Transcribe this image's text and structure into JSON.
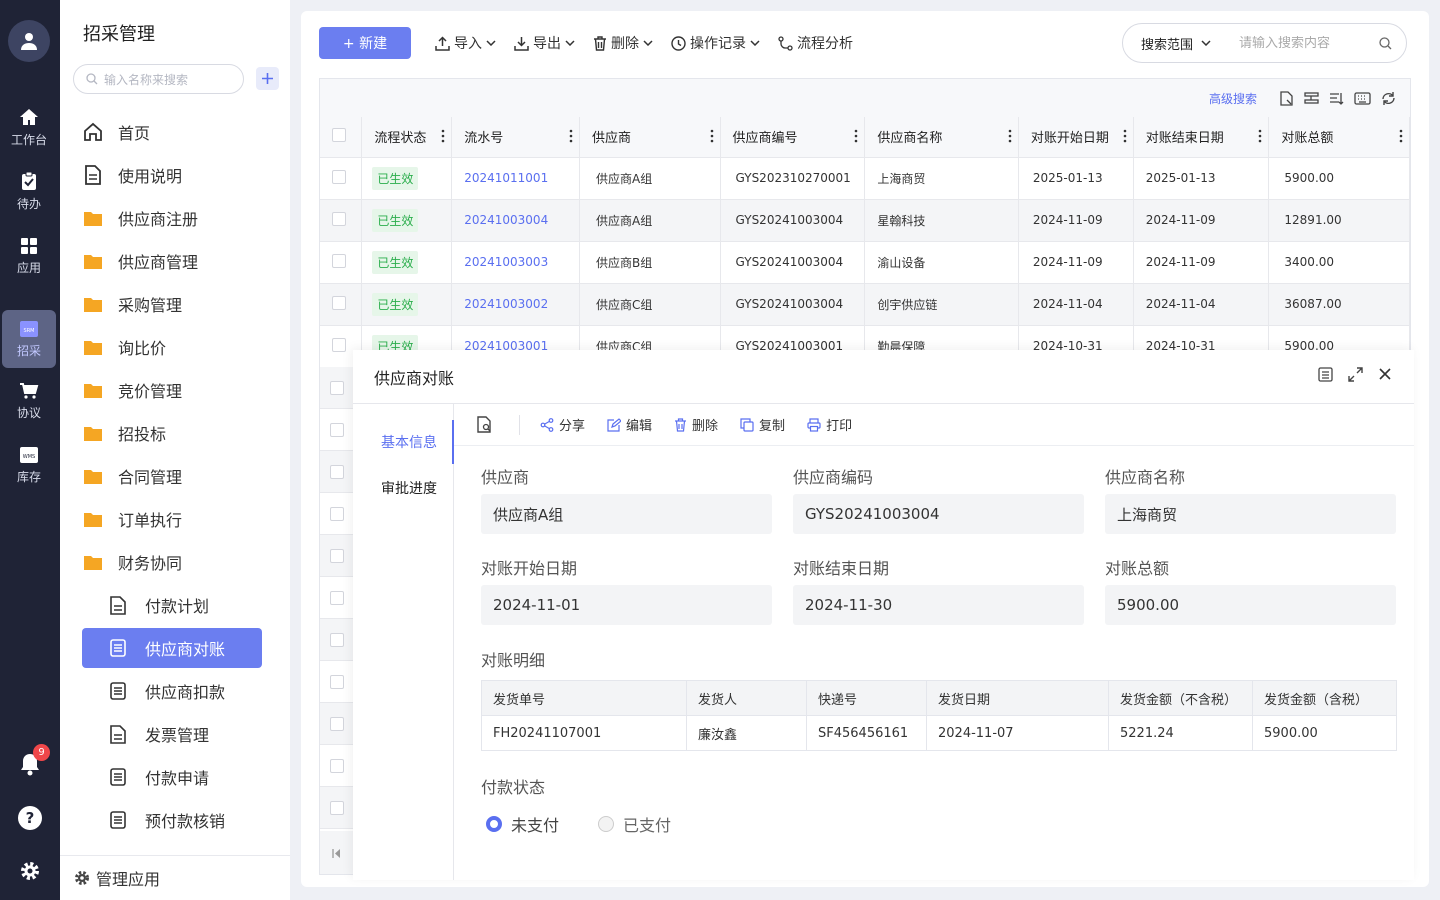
{
  "rail": {
    "items": [
      {
        "label": "工作台"
      },
      {
        "label": "待办"
      },
      {
        "label": "应用"
      },
      {
        "label": "招采",
        "logo": "SRM"
      },
      {
        "label": "协议"
      },
      {
        "label": "库存",
        "logo": "WMS"
      }
    ],
    "notification_count": "9"
  },
  "menu": {
    "title": "招采管理",
    "search_placeholder": "输入名称来搜索",
    "items": [
      {
        "label": "首页"
      },
      {
        "label": "使用说明"
      },
      {
        "label": "供应商注册"
      },
      {
        "label": "供应商管理"
      },
      {
        "label": "采购管理"
      },
      {
        "label": "询比价"
      },
      {
        "label": "竞价管理"
      },
      {
        "label": "招投标"
      },
      {
        "label": "合同管理"
      },
      {
        "label": "订单执行"
      },
      {
        "label": "财务协同"
      }
    ],
    "sub_items": [
      {
        "label": "付款计划"
      },
      {
        "label": "供应商对账"
      },
      {
        "label": "供应商扣款"
      },
      {
        "label": "发票管理"
      },
      {
        "label": "付款申请"
      },
      {
        "label": "预付款核销"
      }
    ],
    "footer": "管理应用"
  },
  "toolbar": {
    "new_label": "+ 新建",
    "import": "导入",
    "export": "导出",
    "delete": "删除",
    "log": "操作记录",
    "flow": "流程分析",
    "search_scope": "搜索范围",
    "search_placeholder": "请输入搜索内容",
    "advanced_search": "高级搜索"
  },
  "grid": {
    "columns": [
      "流程状态",
      "流水号",
      "供应商",
      "供应商编号",
      "供应商名称",
      "对账开始日期",
      "对账结束日期",
      "对账总额"
    ],
    "rows": [
      {
        "status": "已生效",
        "serial": "20241011001",
        "supplier": "供应商A组",
        "code": "GYS202310270001",
        "name": "上海商贸",
        "start": "2025-01-13",
        "end": "2025-01-13",
        "total": "5900.00"
      },
      {
        "status": "已生效",
        "serial": "20241003004",
        "supplier": "供应商A组",
        "code": "GYS20241003004",
        "name": "星翰科技",
        "start": "2024-11-09",
        "end": "2024-11-09",
        "total": "12891.00"
      },
      {
        "status": "已生效",
        "serial": "20241003003",
        "supplier": "供应商B组",
        "code": "GYS20241003004",
        "name": "渝山设备",
        "start": "2024-11-09",
        "end": "2024-11-09",
        "total": "3400.00"
      },
      {
        "status": "已生效",
        "serial": "20241003002",
        "supplier": "供应商C组",
        "code": "GYS20241003004",
        "name": "创宇供应链",
        "start": "2024-11-04",
        "end": "2024-11-04",
        "total": "36087.00"
      },
      {
        "status": "已生效",
        "serial": "20241003001",
        "supplier": "供应商C组",
        "code": "GYS20241003001",
        "name": "勤晨保障",
        "start": "2024-10-31",
        "end": "2024-10-31",
        "total": "5900.00"
      }
    ]
  },
  "drawer": {
    "title": "供应商对账",
    "tabs": [
      "基本信息",
      "审批进度"
    ],
    "actions": {
      "share": "分享",
      "edit": "编辑",
      "delete": "删除",
      "copy": "复制",
      "print": "打印"
    },
    "fields": {
      "supplier_label": "供应商",
      "supplier": "供应商A组",
      "code_label": "供应商编码",
      "code": "GYS20241003004",
      "name_label": "供应商名称",
      "name": "上海商贸",
      "start_label": "对账开始日期",
      "start": "2024-11-01",
      "end_label": "对账结束日期",
      "end": "2024-11-30",
      "total_label": "对账总额",
      "total": "5900.00"
    },
    "detail_title": "对账明细",
    "detail_columns": [
      "发货单号",
      "发货人",
      "快递号",
      "发货日期",
      "发货金额（不含税）",
      "发货金额（含税）"
    ],
    "detail_rows": [
      [
        "FH20241107001",
        "廉汝鑫",
        "SF456456161",
        "2024-11-07",
        "5221.24",
        "5900.00"
      ]
    ],
    "payment_label": "付款状态",
    "payment_options": [
      "未支付",
      "已支付"
    ],
    "payment_selected": "未支付"
  },
  "colors": {
    "accent": "#6b7ef0",
    "rail": "#1f2336",
    "success": "#2bae4c"
  }
}
